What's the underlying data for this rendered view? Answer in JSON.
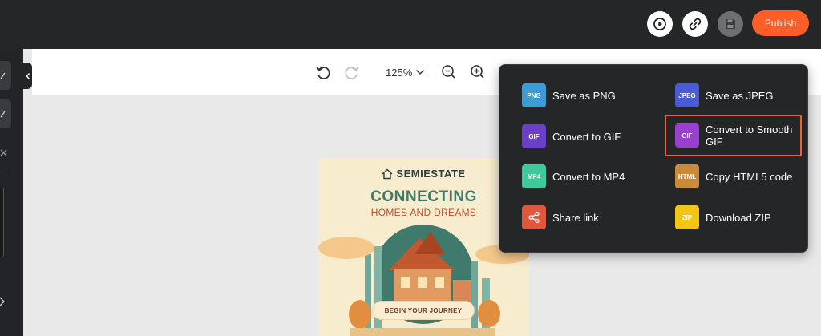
{
  "header": {
    "preview_icon": "play-circle-icon",
    "link_icon": "link-icon",
    "save_icon": "floppy-disk-icon",
    "publish_label": "Publish"
  },
  "toolbar": {
    "undo_icon": "undo-icon",
    "redo_icon": "redo-icon",
    "zoom_value": "125%",
    "zoom_dropdown_icon": "chevron-down-icon",
    "zoom_out_icon": "zoom-out-icon",
    "zoom_in_icon": "zoom-in-icon"
  },
  "canvas": {
    "brand": "SEMIESTATE",
    "headline": "CONNECTING",
    "subline": "HOMES AND DREAMS",
    "cta": "BEGIN YOUR JOURNEY"
  },
  "download_menu": {
    "items": [
      {
        "badge": "PNG",
        "label": "Save as PNG",
        "color": "#3d9bd6"
      },
      {
        "badge": "JPEG",
        "label": "Save as JPEG",
        "color": "#4a5bd4"
      },
      {
        "badge": "GIF",
        "label": "Convert to GIF",
        "color": "#6b3fc8"
      },
      {
        "badge": "GIF",
        "label": "Convert to Smooth GIF",
        "color": "#9b3fd0"
      },
      {
        "badge": "MP4",
        "label": "Convert to MP4",
        "color": "#3ec99a"
      },
      {
        "badge": "HTML",
        "label": "Copy HTML5 code",
        "color": "#c98a3a"
      },
      {
        "badge": "",
        "label": "Share link",
        "color": "#e0573d"
      },
      {
        "badge": "ZIP",
        "label": "Download ZIP",
        "color": "#f2c413"
      }
    ]
  },
  "colors": {
    "accent": "#fb5e26",
    "highlight_border": "#e8623c",
    "topbar": "#252628"
  }
}
